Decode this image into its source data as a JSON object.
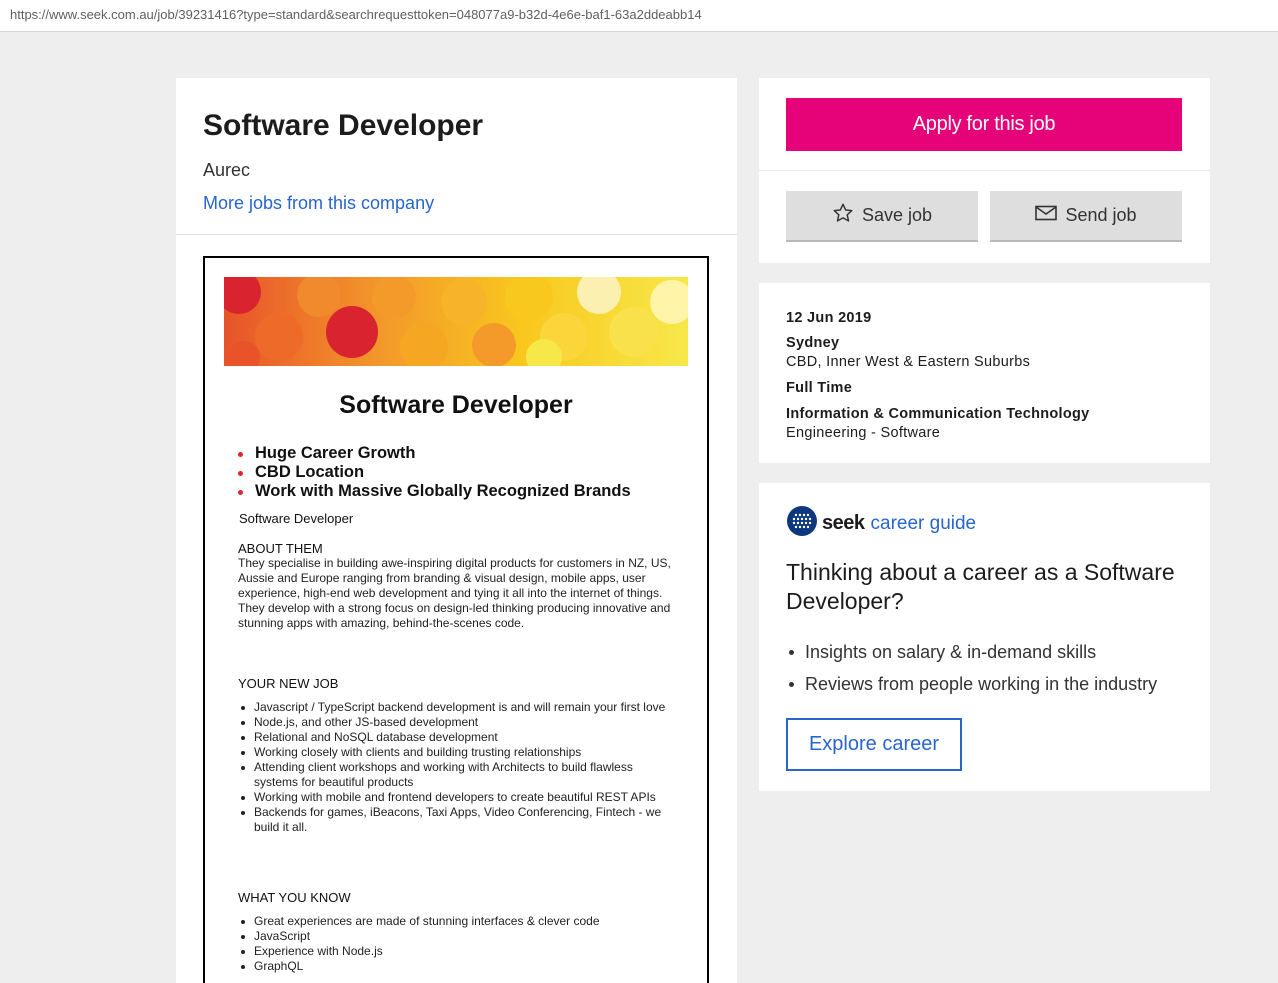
{
  "browser": {
    "url": "https://www.seek.com.au/job/39231416?type=standard&searchrequesttoken=048077a9-b32d-4e6e-baf1-63a2ddeabb14"
  },
  "job": {
    "title": "Software Developer",
    "company": "Aurec",
    "more_jobs_link": "More jobs from this company"
  },
  "advert": {
    "title": "Software Developer",
    "highlights": [
      "Huge Career Growth",
      "CBD Location",
      "Work with Massive Globally Recognized Brands"
    ],
    "subtitle": "Software Developer",
    "about_heading": "ABOUT THEM",
    "about_text": "They specialise in building awe-inspiring digital products for customers in NZ, US, Aussie and Europe ranging from branding & visual design, mobile apps, user experience, high-end web development and tying it all into the internet of things. They develop with a strong focus on design-led thinking producing innovative and stunning apps with amazing, behind-the-scenes code.",
    "new_job_heading": "YOUR NEW JOB",
    "new_job_items": [
      "Javascript / TypeScript backend development is and will remain your first love",
      "Node.js, and other JS-based development",
      "Relational and NoSQL database development",
      "Working closely with clients and building trusting relationships",
      "Attending client workshops and working with Architects to build flawless systems for beautiful products",
      "Working with mobile and frontend developers to create beautiful REST APIs",
      "Backends for games, iBeacons, Taxi Apps, Video Conferencing, Fintech - we build it all."
    ],
    "know_heading": "WHAT YOU KNOW",
    "know_items": [
      "Great experiences are made of stunning interfaces & clever code",
      "JavaScript",
      "Experience with Node.js",
      "GraphQL"
    ]
  },
  "actions": {
    "apply_label": "Apply for this job",
    "save_label": "Save job",
    "send_label": "Send job",
    "apply_color": "#e60278"
  },
  "details": {
    "date": "12 Jun 2019",
    "location": "Sydney",
    "area": "CBD, Inner West & Eastern Suburbs",
    "work_type": "Full Time",
    "classification": "Information & Communication Technology",
    "sub_classification": "Engineering - Software"
  },
  "career_guide": {
    "brand": "seek",
    "product": "career guide",
    "heading": "Thinking about a career as a Software Developer?",
    "points": [
      "Insights on salary & in-demand skills",
      "Reviews from people working in the industry"
    ],
    "button_label": "Explore career",
    "link_color": "#2765cf"
  }
}
